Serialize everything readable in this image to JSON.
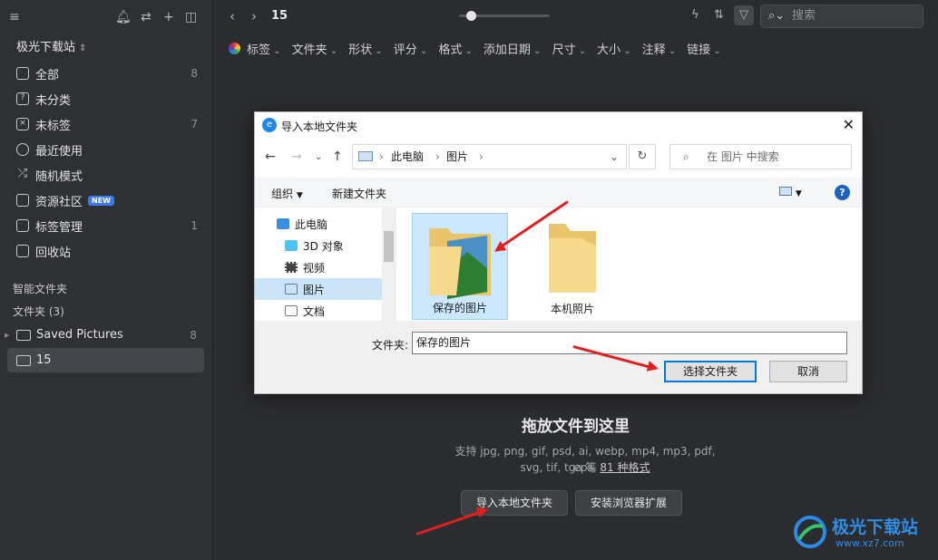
{
  "sidebar": {
    "library_name": "极光下载站",
    "items": [
      {
        "label": "全部",
        "count": "8"
      },
      {
        "label": "未分类",
        "count": ""
      },
      {
        "label": "未标签",
        "count": "7"
      },
      {
        "label": "最近使用",
        "count": ""
      },
      {
        "label": "随机模式",
        "count": ""
      },
      {
        "label": "资源社区",
        "count": "",
        "badge": "NEW"
      },
      {
        "label": "标签管理",
        "count": "1"
      },
      {
        "label": "回收站",
        "count": ""
      }
    ],
    "smart_folders": "智能文件夹",
    "folders_header": "文件夹 (3)",
    "folders": [
      {
        "label": "Saved Pictures",
        "count": "8"
      },
      {
        "label": "15",
        "count": ""
      }
    ]
  },
  "toolbar": {
    "folder_title": "15",
    "search_placeholder": "搜索"
  },
  "filters": [
    "标签",
    "文件夹",
    "形状",
    "评分",
    "格式",
    "添加日期",
    "尺寸",
    "大小",
    "注释",
    "链接"
  ],
  "dropzone": {
    "title": "拖放文件到这里",
    "sub_line1": "支持 jpg, png, gif, psd, ai, webp, mp4, mp3, pdf, eps,",
    "sub_line2_prefix": "svg, tif, tga 等 ",
    "sub_line2_link": "81 种格式",
    "import_button": "导入本地文件夹",
    "extension_button": "安装浏览器扩展"
  },
  "dialog": {
    "title": "导入本地文件夹",
    "breadcrumb": [
      "此电脑",
      "图片"
    ],
    "search_placeholder": "在 图片 中搜索",
    "organize": "组织",
    "new_folder": "新建文件夹",
    "tree": [
      "此电脑",
      "3D 对象",
      "视频",
      "图片",
      "文档"
    ],
    "files": [
      "保存的图片",
      "本机照片"
    ],
    "folder_label": "文件夹:",
    "folder_value": "保存的图片",
    "select_button": "选择文件夹",
    "cancel_button": "取消"
  },
  "watermark": {
    "name": "极光下载站",
    "url": "www.xz7.com"
  },
  "colors": {
    "accent": "#3b7bf0",
    "annotation_arrow": "#e02020"
  }
}
